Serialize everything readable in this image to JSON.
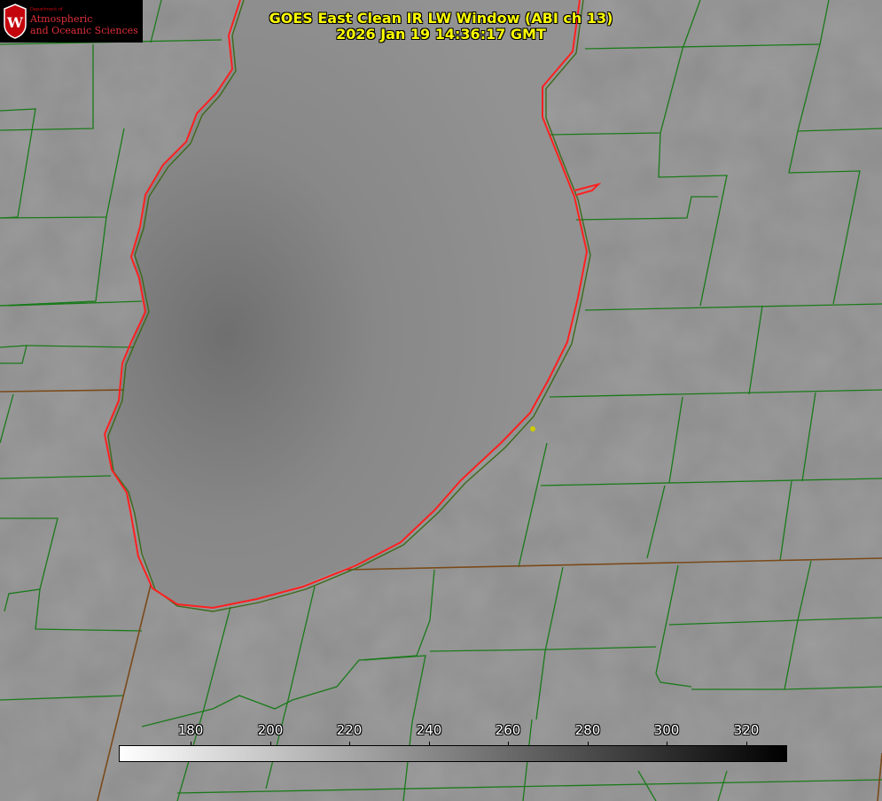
{
  "title": {
    "line1": "GOES East Clean IR LW Window (ABI ch 13)",
    "line2": "2026 Jan 19 14:36:17 GMT"
  },
  "logo": {
    "small_text": "Department of",
    "line1": "Atmospheric",
    "line2": "and Oceanic Sciences",
    "crest_letter": "W"
  },
  "colorbar": {
    "label_color": "#ffffff",
    "gradient_from": "#ffffff",
    "gradient_to": "#000000",
    "ticks": [
      "180",
      "200",
      "220",
      "240",
      "260",
      "280",
      "300",
      "320"
    ]
  },
  "map_style": {
    "county_line_color": "#1a7a1a",
    "state_line_color": "#7a4a1a",
    "lake_outline_color": "#ff2020",
    "marker_color": "#cccc00"
  }
}
